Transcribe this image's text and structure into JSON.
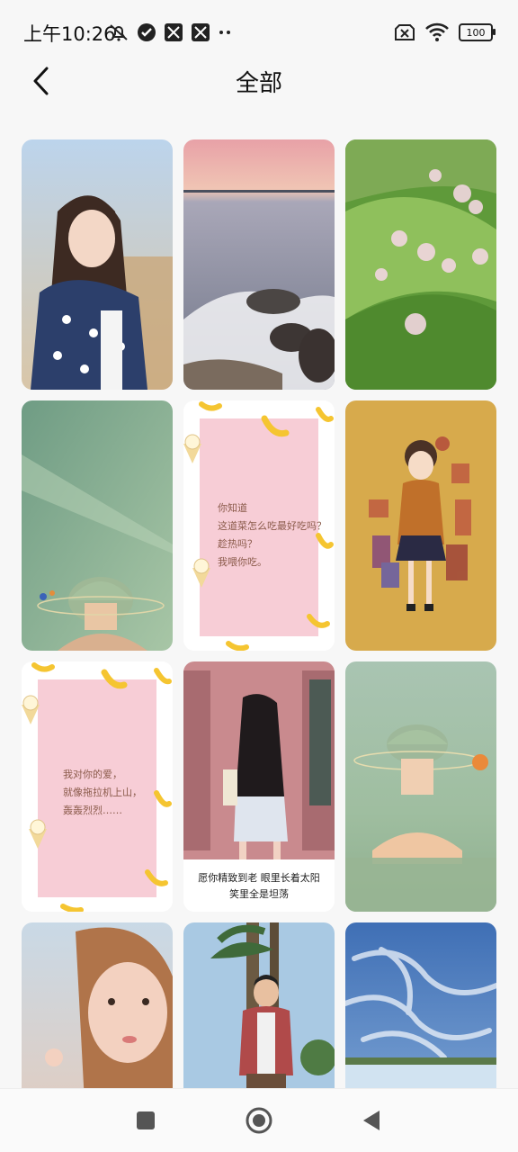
{
  "status_bar": {
    "time_label": "上午10:26",
    "battery": "100",
    "icons": [
      "bell-muted-icon",
      "check-circle-icon",
      "app-icon",
      "app-icon",
      "more-dots-icon",
      "sim-off-icon",
      "wifi-icon",
      "battery-icon"
    ]
  },
  "header": {
    "title": "全部",
    "back_icon": "chevron-left-icon"
  },
  "wallpapers": [
    {
      "name": "wallpaper-girl-scarf"
    },
    {
      "name": "wallpaper-sunset-sea"
    },
    {
      "name": "wallpaper-green-hills"
    },
    {
      "name": "wallpaper-green-illustration"
    },
    {
      "name": "wallpaper-banana-note-1",
      "text": "你知道\n这道菜怎么吃最好吃吗？\n趁热吗？\n我喂你吃。"
    },
    {
      "name": "wallpaper-anime-girl-yellow"
    },
    {
      "name": "wallpaper-banana-note-2",
      "text": "我对你的爱，\n就像拖拉机上山，\n轰轰烈烈……"
    },
    {
      "name": "wallpaper-pink-door",
      "caption_line1": "愿你精致到老  眼里长着太阳",
      "caption_line2": "笑里全是坦荡"
    },
    {
      "name": "wallpaper-girl-in-water"
    },
    {
      "name": "wallpaper-portrait-woman"
    },
    {
      "name": "wallpaper-man-palms"
    },
    {
      "name": "wallpaper-sky-clouds"
    }
  ],
  "nav": {
    "recents_icon": "square-icon",
    "home_icon": "circle-icon",
    "back_icon": "triangle-back-icon"
  }
}
